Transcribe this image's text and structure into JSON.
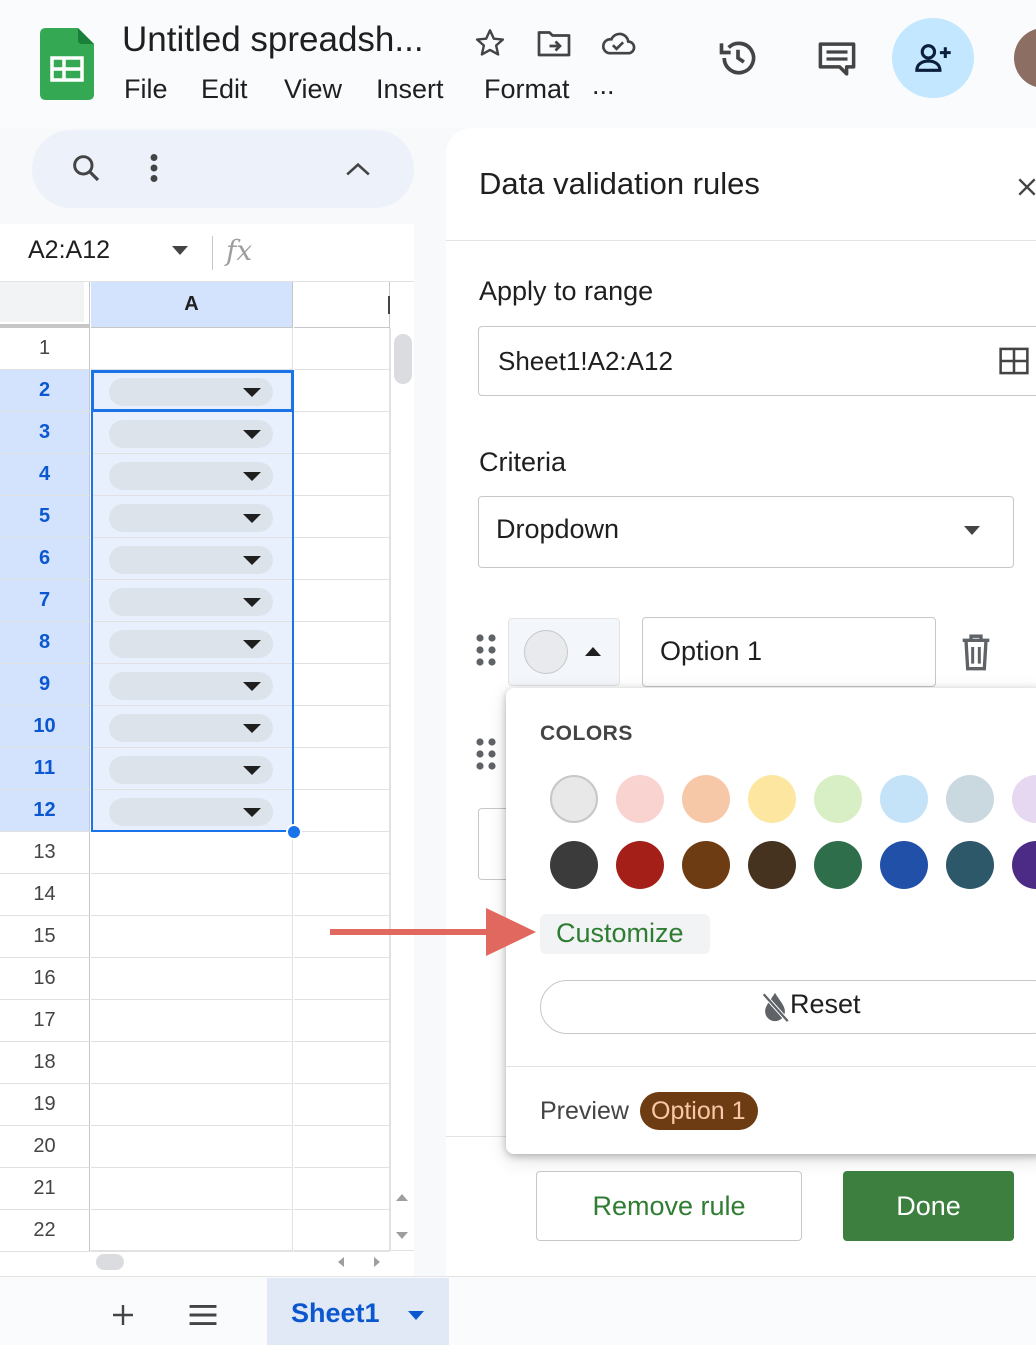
{
  "app": {
    "title": "Untitled spreadsh...",
    "menu": [
      "File",
      "Edit",
      "View",
      "Insert",
      "Format",
      "..."
    ]
  },
  "formula_bar": {
    "name_box": "A2:A12",
    "fx": "fx"
  },
  "grid": {
    "column_headers": [
      "A"
    ],
    "rows": [
      "1",
      "2",
      "3",
      "4",
      "5",
      "6",
      "7",
      "8",
      "9",
      "10",
      "11",
      "12",
      "13",
      "14",
      "15",
      "16",
      "17",
      "18",
      "19",
      "20",
      "21",
      "22"
    ],
    "selected_rows": [
      "2",
      "3",
      "4",
      "5",
      "6",
      "7",
      "8",
      "9",
      "10",
      "11",
      "12"
    ]
  },
  "sheet_tab": {
    "name": "Sheet1"
  },
  "panel": {
    "title": "Data validation rules",
    "apply_to_range_label": "Apply to range",
    "range_value": "Sheet1!A2:A12",
    "criteria_label": "Criteria",
    "criteria_value": "Dropdown",
    "option1_value": "Option 1",
    "remove_rule_label": "Remove rule",
    "done_label": "Done"
  },
  "color_popup": {
    "heading": "COLORS",
    "customize_label": "Customize",
    "reset_label": "Reset",
    "preview_label": "Preview",
    "preview_chip": "Option 1",
    "light_colors": [
      "#e8e8e8",
      "#f8d3d0",
      "#f7c8a8",
      "#fde7a0",
      "#d8efc6",
      "#c5e3f8",
      "#cad8e0",
      "#e7d8f2"
    ],
    "dark_colors": [
      "#3b3b3b",
      "#a31f17",
      "#6e3c12",
      "#45331f",
      "#2e6e4a",
      "#2150a8",
      "#2d5869",
      "#4b2b86"
    ]
  },
  "colors": {
    "accent_blue": "#0b57d0",
    "done_green": "#3c7f3f",
    "customize_green": "#2f7d32",
    "arrow_red": "#e0685e",
    "preview_chip_bg": "#6e3c12",
    "preview_chip_text": "#f7c8a8"
  }
}
